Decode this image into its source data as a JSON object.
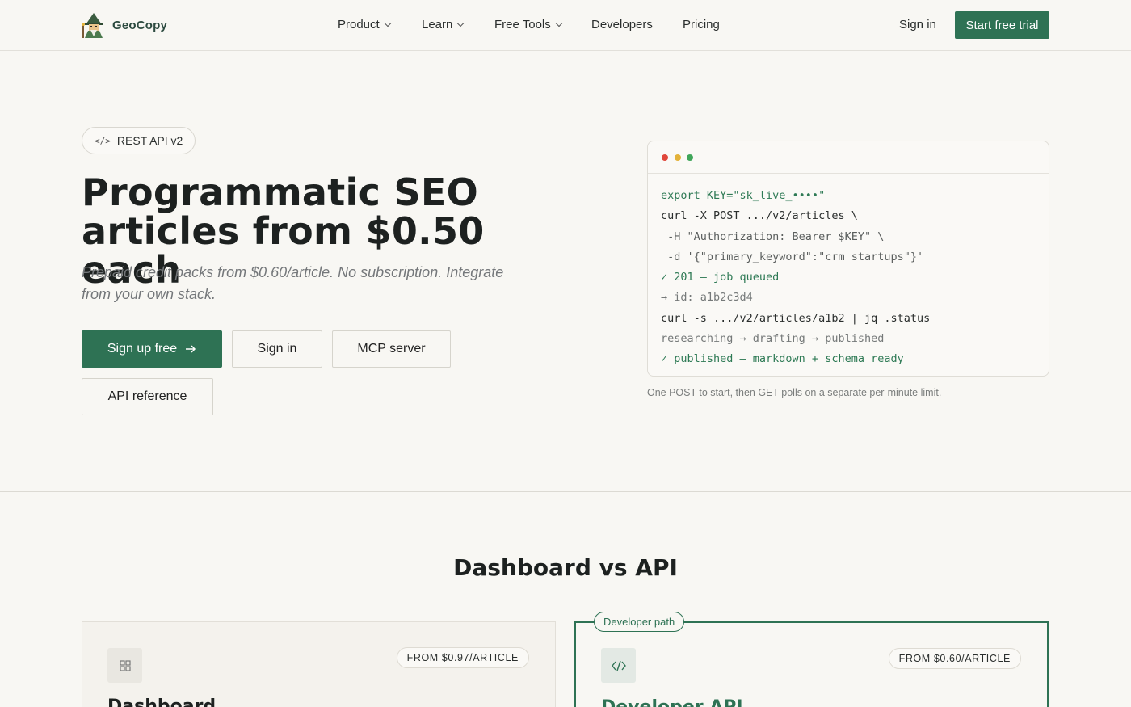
{
  "nav": {
    "brand": "GeoCopy",
    "items": [
      {
        "label": "Product",
        "dropdown": true
      },
      {
        "label": "Learn",
        "dropdown": true
      },
      {
        "label": "Free Tools",
        "dropdown": true
      },
      {
        "label": "Developers",
        "dropdown": false
      },
      {
        "label": "Pricing",
        "dropdown": false
      }
    ],
    "sign_in": "Sign in",
    "cta": "Start free trial"
  },
  "hero": {
    "badge_icon": "code-icon",
    "badge": "REST API v2",
    "title_line1": "Programmatic SEO",
    "title_line2": "articles from $0.50 each",
    "subtitle": "Prepaid credit packs from $0.60/article. No subscription. Integrate from your own stack.",
    "buttons": {
      "signup": "Sign up free",
      "signin": "Sign in",
      "mcp": "MCP server",
      "api_ref": "API reference"
    }
  },
  "terminal": {
    "dots": [
      "#e0473b",
      "#e3b23a",
      "#3fa65a"
    ],
    "lines": [
      {
        "text": "export KEY=\"sk_live_••••\"",
        "style": "green"
      },
      {
        "text": "curl -X POST .../v2/articles \\",
        "style": "dark"
      },
      {
        "text": " -H \"Authorization: Bearer $KEY\" \\",
        "style": "grey"
      },
      {
        "text": " -d '{\"primary_keyword\":\"crm startups\"}'",
        "style": "grey"
      },
      {
        "text": "✓ 201 — job queued",
        "style": "green"
      },
      {
        "text": "→ id: a1b2c3d4",
        "style": "muted"
      },
      {
        "text": "curl -s .../v2/articles/a1b2 | jq .status",
        "style": "dark"
      },
      {
        "text": "researching → drafting → published",
        "style": "muted"
      },
      {
        "text": "✓ published — markdown + schema ready",
        "style": "green"
      }
    ],
    "caption": "One POST to start, then GET polls on a separate per-minute limit."
  },
  "comparison": {
    "title": "Dashboard vs API",
    "dashboard": {
      "title": "Dashboard",
      "price": "FROM $0.97/ARTICLE"
    },
    "developer": {
      "tag": "Developer path",
      "title": "Developer API",
      "price": "FROM $0.60/ARTICLE"
    }
  },
  "colors": {
    "accent": "#2e7254",
    "background": "#f8f7f3"
  }
}
